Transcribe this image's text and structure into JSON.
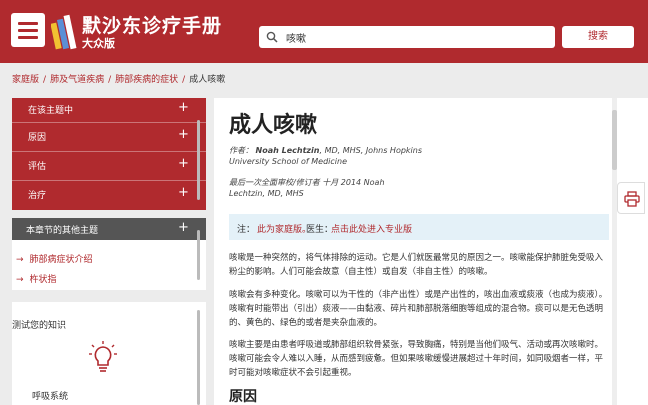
{
  "header": {
    "brand_title": "默沙东诊疗手册",
    "brand_subtitle": "大众版",
    "search_value": "咳嗽",
    "search_button": "搜索",
    "brand_color": "#b02a2e"
  },
  "breadcrumb": [
    {
      "label": "家庭版"
    },
    {
      "label": "肺及气道疾病"
    },
    {
      "label": "肺部疾病的症状"
    },
    {
      "label": "成人咳嗽"
    }
  ],
  "sidebar": {
    "topic_header": "在该主题中",
    "topic_items": [
      {
        "label": "原因"
      },
      {
        "label": "评估"
      },
      {
        "label": "治疗"
      }
    ],
    "other_header": "本章节的其他主题",
    "other_links": [
      {
        "label": "肺部病症状介绍"
      },
      {
        "label": "杵状指"
      }
    ],
    "quiz_label": "测试您的知识",
    "quiz_card_label": "呼吸系统"
  },
  "article": {
    "title": "成人咳嗽",
    "author_prefix": "作者：",
    "author_name": "Noah Lechtzin",
    "author_credentials": ", MD, MHS, Johns Hopkins",
    "author_affiliation": "University School of Medicine",
    "review_line1": "最后一次全面审校/修订者 十月 2014 Noah",
    "review_line2": "Lechtzin, MD, MHS",
    "notice_prefix": "注：",
    "notice_link1": "此为家庭版。",
    "notice_middle": "医生：",
    "notice_link2": "点击此处进入专业版",
    "para1": "咳嗽是一种突然的，将气体排除的运动。它是人们就医最常见的原因之一。咳嗽能保护肺脏免受吸入粉尘的影响。人们可能会故意（自主性）或自发（非自主性）的咳嗽。",
    "para2": "咳嗽会有多种变化。咳嗽可以为干性的（非产出性）或是产出性的，咳出血液或痰液（也成为痰液）。咳嗽有时能带出（引出）痰液——由黏液、碎片和肺部脱落细胞等组成的混合物。痰可以是无色透明的、黄色的、绿色的或者是夹杂血液的。",
    "para3": "咳嗽主要是由患者呼吸道或肺部组织软骨紧张，导致胸痛，特别是当他们吸气、活动或再次咳嗽时。咳嗽可能会令人难以入睡，从而感到疲惫。但如果咳嗽缓慢进展超过十年时间，如同吸烟者一样，平时可能对咳嗽症状不会引起重视。",
    "section_title": "原因"
  },
  "icons": {
    "menu": "hamburger-icon",
    "search": "search-icon",
    "print": "print-icon",
    "bulb": "lightbulb-icon"
  }
}
